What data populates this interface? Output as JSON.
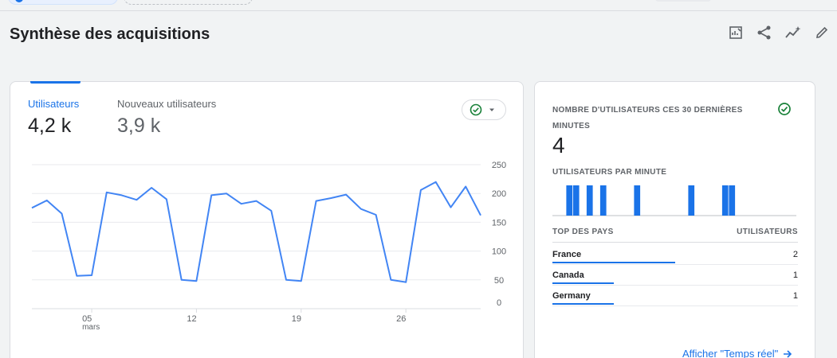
{
  "title": "Synthèse des acquisitions",
  "colors": {
    "accent": "#1a73e8",
    "success": "#188038",
    "grid": "#e8eaed",
    "text": "#202124",
    "muted": "#5f6368"
  },
  "toolbar": {
    "icons": [
      "customize-report-icon",
      "share-icon",
      "insights-icon",
      "edit-icon"
    ]
  },
  "metrics": [
    {
      "label": "Utilisateurs",
      "value": "4,2 k",
      "selected": true
    },
    {
      "label": "Nouveaux utilisateurs",
      "value": "3,9 k",
      "selected": false
    }
  ],
  "chart_data": {
    "type": "line",
    "series": [
      {
        "values": [
          175,
          188,
          165,
          57,
          58,
          202,
          197,
          189,
          210,
          190,
          50,
          48,
          197,
          200,
          182,
          187,
          170,
          50,
          48,
          187,
          192,
          198,
          173,
          163,
          50,
          46,
          206,
          220,
          176,
          212,
          162
        ]
      }
    ],
    "ylim": [
      0,
      250
    ],
    "y_ticks": [
      "0",
      "50",
      "100",
      "150",
      "200",
      "250"
    ],
    "x_ticks": [
      {
        "label": "05",
        "sublabel": "mars",
        "index": 4
      },
      {
        "label": "12",
        "index": 11
      },
      {
        "label": "19",
        "index": 18
      },
      {
        "label": "26",
        "index": 25
      }
    ],
    "grid": true
  },
  "realtime": {
    "title": "Nombre d'utilisateurs ces 30 dernières minutes",
    "value": "4",
    "per_minute_label": "Utilisateurs par minute",
    "per_minute": [
      0,
      0,
      1,
      1,
      0,
      1,
      0,
      1,
      0,
      0,
      0,
      0,
      1,
      0,
      0,
      0,
      0,
      0,
      0,
      0,
      1,
      0,
      0,
      0,
      0,
      1,
      1,
      0,
      0,
      0,
      0,
      0,
      0,
      0,
      0,
      0
    ],
    "table_head": {
      "country": "Top des pays",
      "users": "Utilisateurs"
    },
    "countries": [
      {
        "name": "France",
        "value": "2",
        "share": 1.0
      },
      {
        "name": "Canada",
        "value": "1",
        "share": 0.5
      },
      {
        "name": "Germany",
        "value": "1",
        "share": 0.5
      }
    ],
    "link": "Afficher \"Temps réel\""
  }
}
